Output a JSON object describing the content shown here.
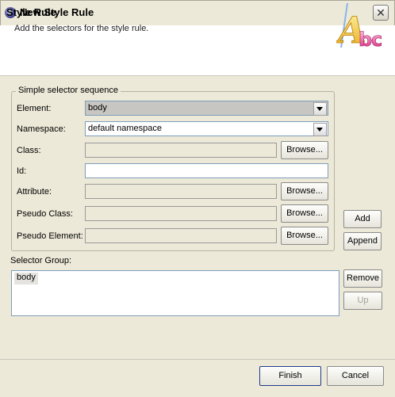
{
  "window": {
    "title": "New Style Rule",
    "close_symbol": "✕"
  },
  "header": {
    "title": "Style Rule",
    "description": "Add the selectors for the style rule.",
    "logo_text": "Abc"
  },
  "group": {
    "title": "Simple selector sequence",
    "element": {
      "label": "Element:",
      "value": "body"
    },
    "namespace": {
      "label": "Namespace:",
      "value": "default namespace"
    },
    "class": {
      "label": "Class:",
      "value": ""
    },
    "id": {
      "label": "Id:",
      "value": ""
    },
    "attribute": {
      "label": "Attribute:",
      "value": ""
    },
    "pseudo_class": {
      "label": "Pseudo Class:",
      "value": ""
    },
    "pseudo_element": {
      "label": "Pseudo Element:",
      "value": ""
    },
    "browse_label": "Browse..."
  },
  "side": {
    "add": "Add",
    "append": "Append"
  },
  "selector_group": {
    "label": "Selector Group:",
    "items": [
      "body"
    ],
    "remove": "Remove",
    "up": "Up"
  },
  "footer": {
    "finish": "Finish",
    "cancel": "Cancel"
  }
}
